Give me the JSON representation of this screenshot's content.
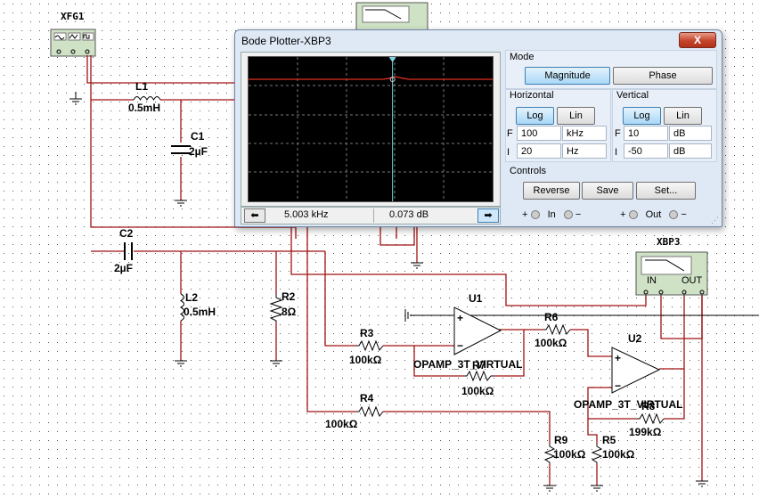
{
  "schematic": {
    "function_generator": "XFG1",
    "components": {
      "L1": {
        "name": "L1",
        "value": "0.5mH"
      },
      "C1": {
        "name": "C1",
        "value": "2µF"
      },
      "C2": {
        "name": "C2",
        "value": "2µF"
      },
      "L2": {
        "name": "L2",
        "value": "0.5mH"
      },
      "R2": {
        "name": "R2",
        "value": "8Ω"
      },
      "R3": {
        "name": "R3",
        "value": "100kΩ"
      },
      "R4": {
        "name": "R4",
        "value": "100kΩ"
      },
      "R5": {
        "name": "R5",
        "value": "100kΩ"
      },
      "R6": {
        "name": "R6",
        "value": "100kΩ"
      },
      "R7": {
        "name": "R7",
        "value": "100kΩ"
      },
      "R8": {
        "name": "R8",
        "value": "199kΩ"
      },
      "R9": {
        "name": "R9",
        "value": "100kΩ"
      },
      "U1": {
        "name": "U1",
        "model": "OPAMP_3T_VIRTUAL"
      },
      "U2": {
        "name": "U2",
        "model": "OPAMP_3T_VIRTUAL"
      }
    },
    "bode_instrument": {
      "name": "XBP3",
      "in_label": "IN",
      "out_label": "OUT"
    }
  },
  "bode_window": {
    "title": "Bode Plotter-XBP3",
    "close_label": "X",
    "mode": {
      "label": "Mode",
      "magnitude": "Magnitude",
      "phase": "Phase",
      "selected": "Magnitude"
    },
    "horizontal": {
      "label": "Horizontal",
      "log": "Log",
      "lin": "Lin",
      "selected": "Log",
      "f_label": "F",
      "f_value": "100",
      "f_unit": "kHz",
      "i_label": "I",
      "i_value": "20",
      "i_unit": "Hz"
    },
    "vertical": {
      "label": "Vertical",
      "log": "Log",
      "lin": "Lin",
      "selected": "Log",
      "f_label": "F",
      "f_value": "10",
      "f_unit": "dB",
      "i_label": "I",
      "i_value": "-50",
      "i_unit": "dB"
    },
    "controls": {
      "label": "Controls",
      "reverse": "Reverse",
      "save": "Save",
      "set": "Set..."
    },
    "terminals": {
      "in": "In",
      "out": "Out",
      "plus": "+",
      "minus": "−"
    },
    "readout": {
      "frequency": "5.003 kHz",
      "magnitude": "0.073 dB"
    },
    "cursor_fraction": 0.59
  }
}
